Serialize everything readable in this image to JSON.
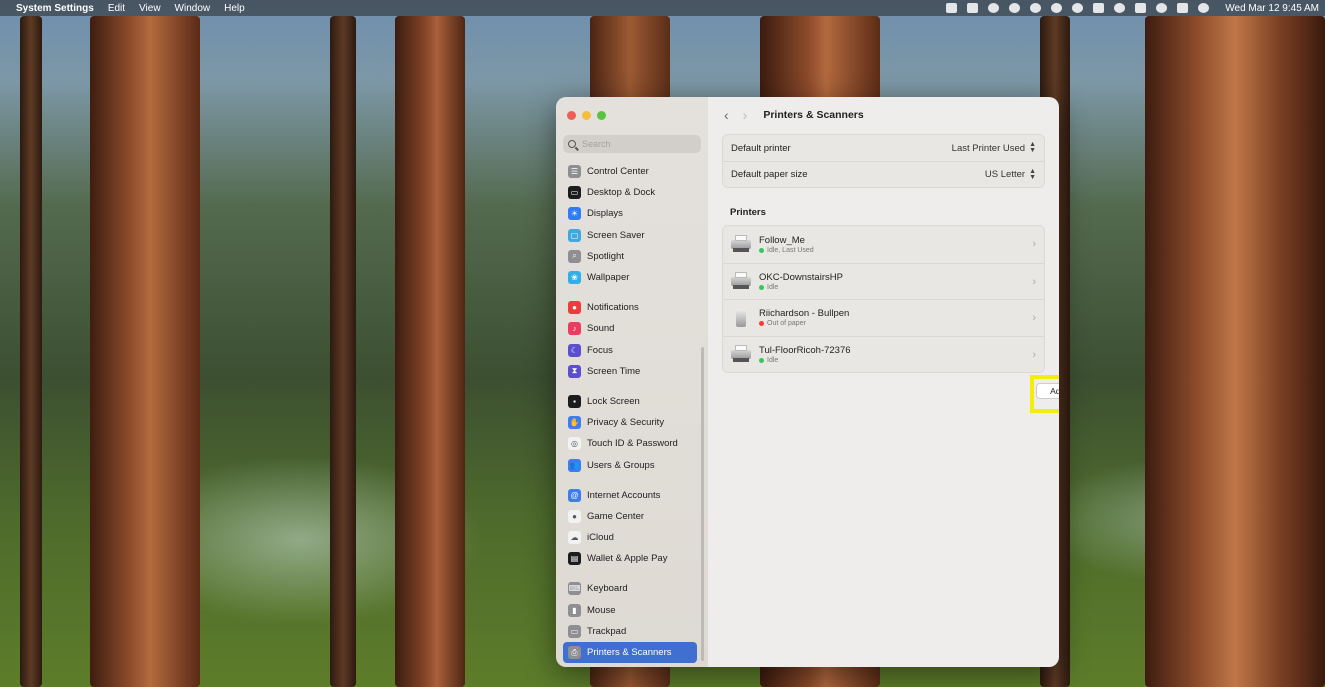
{
  "menubar": {
    "app": "System Settings",
    "items": [
      "Edit",
      "View",
      "Window",
      "Help"
    ],
    "clock": "Wed Mar 12  9:45 AM"
  },
  "window": {
    "search_placeholder": "Search",
    "title": "Printers & Scanners",
    "sidebar": [
      {
        "label": "Control Center",
        "icon": "control-center-icon",
        "color": "#8e8e93"
      },
      {
        "label": "Desktop & Dock",
        "icon": "desktop-dock-icon",
        "color": "#1c1c1e"
      },
      {
        "label": "Displays",
        "icon": "displays-icon",
        "color": "#2f7cf6"
      },
      {
        "label": "Screen Saver",
        "icon": "screen-saver-icon",
        "color": "#40a8e0"
      },
      {
        "label": "Spotlight",
        "icon": "spotlight-icon",
        "color": "#8e8e93"
      },
      {
        "label": "Wallpaper",
        "icon": "wallpaper-icon",
        "color": "#30b0e8"
      },
      {
        "label": "Notifications",
        "icon": "notifications-icon",
        "color": "#ef3b3b"
      },
      {
        "label": "Sound",
        "icon": "sound-icon",
        "color": "#ef3b5f"
      },
      {
        "label": "Focus",
        "icon": "focus-icon",
        "color": "#5b4fd0"
      },
      {
        "label": "Screen Time",
        "icon": "screen-time-icon",
        "color": "#5b4fd0"
      },
      {
        "label": "Lock Screen",
        "icon": "lock-screen-icon",
        "color": "#1c1c1e"
      },
      {
        "label": "Privacy & Security",
        "icon": "privacy-hand-icon",
        "color": "#3d7cf2"
      },
      {
        "label": "Touch ID & Password",
        "icon": "fingerprint-icon",
        "color": "#f2f2f2"
      },
      {
        "label": "Users & Groups",
        "icon": "users-icon",
        "color": "#3d7cf2"
      },
      {
        "label": "Internet Accounts",
        "icon": "at-sign-icon",
        "color": "#3d7cf2"
      },
      {
        "label": "Game Center",
        "icon": "game-center-icon",
        "color": "#f2f2f2"
      },
      {
        "label": "iCloud",
        "icon": "icloud-icon",
        "color": "#f2f2f2"
      },
      {
        "label": "Wallet & Apple Pay",
        "icon": "wallet-icon",
        "color": "#1c1c1e"
      },
      {
        "label": "Keyboard",
        "icon": "keyboard-icon",
        "color": "#8e8e93"
      },
      {
        "label": "Mouse",
        "icon": "mouse-icon",
        "color": "#8e8e93"
      },
      {
        "label": "Trackpad",
        "icon": "trackpad-icon",
        "color": "#8e8e93"
      },
      {
        "label": "Printers & Scanners",
        "icon": "printer-icon",
        "color": "#8e8e93"
      }
    ],
    "defaults": {
      "printer_label": "Default printer",
      "printer_value": "Last Printer Used",
      "paper_label": "Default paper size",
      "paper_value": "US Letter"
    },
    "printers_title": "Printers",
    "printers": [
      {
        "name": "Follow_Me",
        "status": "Idle, Last Used",
        "status_color": "#34c759"
      },
      {
        "name": "OKC-DownstairsHP",
        "status": "Idle",
        "status_color": "#34c759"
      },
      {
        "name": "Riichardson - Bullpen",
        "status": "Out of paper",
        "status_color": "#ff3b30"
      },
      {
        "name": "Tul-FloorRicoh-72376",
        "status": "Idle",
        "status_color": "#34c759"
      }
    ],
    "add_button": "Add Printer, Scanner, or Fax...",
    "help_button": "?"
  }
}
